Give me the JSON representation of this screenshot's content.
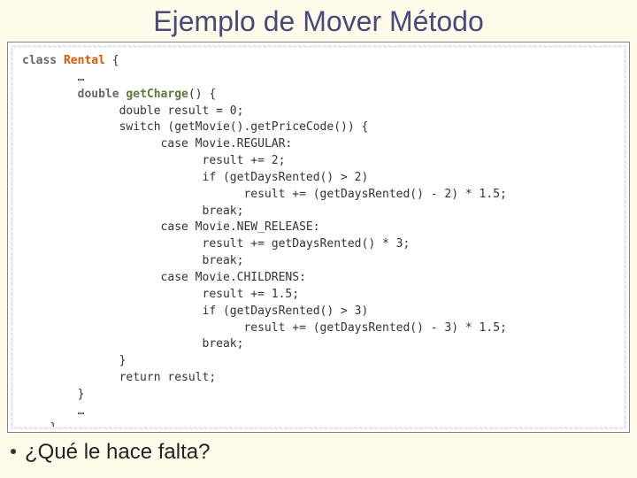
{
  "title": "Ejemplo de Mover Método",
  "bullet": "¿Qué le hace falta?",
  "code": {
    "kw_class": "class",
    "class_name": "Rental",
    "brace_open": " {",
    "ellipsis": "…",
    "kw_double": "double",
    "method_name": "getCharge",
    "method_sig": "() {",
    "l_result_decl": "double result = 0;",
    "l_switch": "switch (getMovie().getPriceCode()) {",
    "l_case_reg": "case Movie.REGULAR:",
    "l_reg_add": "result += 2;",
    "l_reg_if": "if (getDaysRented() > 2)",
    "l_reg_calc": "result += (getDaysRented() - 2) * 1.5;",
    "l_break": "break;",
    "l_case_new": "case Movie.NEW_RELEASE:",
    "l_new_calc": "result += getDaysRented() * 3;",
    "l_case_child": "case Movie.CHILDRENS:",
    "l_child_add": "result += 1.5;",
    "l_child_if": "if (getDaysRented() > 3)",
    "l_child_calc": "result += (getDaysRented() - 3) * 1.5;",
    "l_switch_close": "}",
    "l_return": "return result;",
    "l_method_close": "}",
    "l_class_close": "}"
  }
}
